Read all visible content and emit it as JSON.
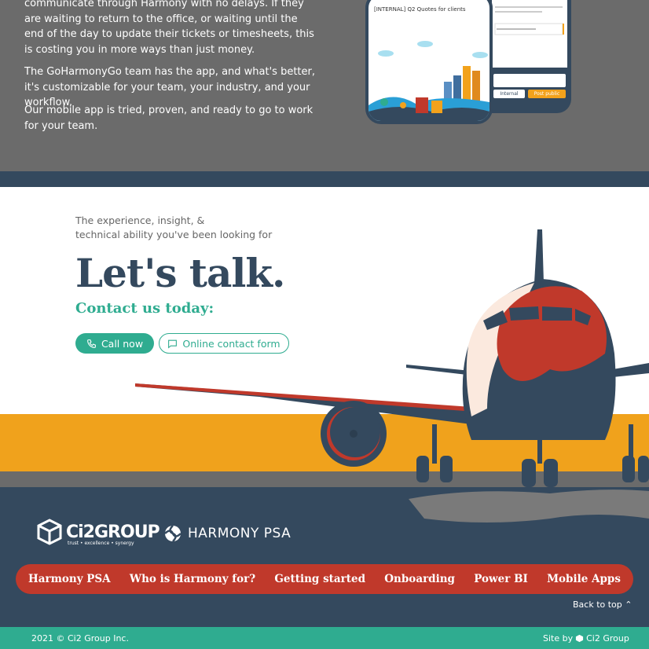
{
  "intro_paragraphs": [
    "communicate through Harmony with no delays. If they are waiting to return to the office, or waiting until the end of the day to update their tickets or timesheets, this is costing you in more ways than just money.",
    "The GoHarmonyGo team has the app, and what's better, it's customizable for your team, your industry, and your workflow.",
    "Our mobile app is tried, proven, and ready to go to work for your team."
  ],
  "phone": {
    "ticket_title": "[INTERNAL] Q2 Quotes for clients",
    "btn_internal": "Internal",
    "btn_post_public": "Post public"
  },
  "contact": {
    "intro_line1": "The experience, insight, &",
    "intro_line2": "technical ability you've been looking for",
    "headline": "Let's talk.",
    "subheadline": "Contact us today:",
    "call_label": "Call now",
    "form_label": "Online contact form"
  },
  "logos": {
    "ci2_name": "Ci2GROUP",
    "ci2_tagline": "trust • excellence • synergy",
    "harmony_name": "HARMONY PSA"
  },
  "nav": {
    "items": [
      "Harmony PSA",
      "Who is Harmony for?",
      "Getting started",
      "Onboarding",
      "Power BI",
      "Mobile Apps"
    ]
  },
  "back_to_top": "Back to top",
  "bottom_bar": {
    "copyright": "2021 © Ci2 Group Inc.",
    "site_by_prefix": "Site by",
    "site_by_name": "Ci2 Group"
  },
  "colors": {
    "navy": "#34495e",
    "teal": "#2fac90",
    "red": "#c0392b",
    "orange": "#f0a21c",
    "gray": "#6b6b6b"
  }
}
